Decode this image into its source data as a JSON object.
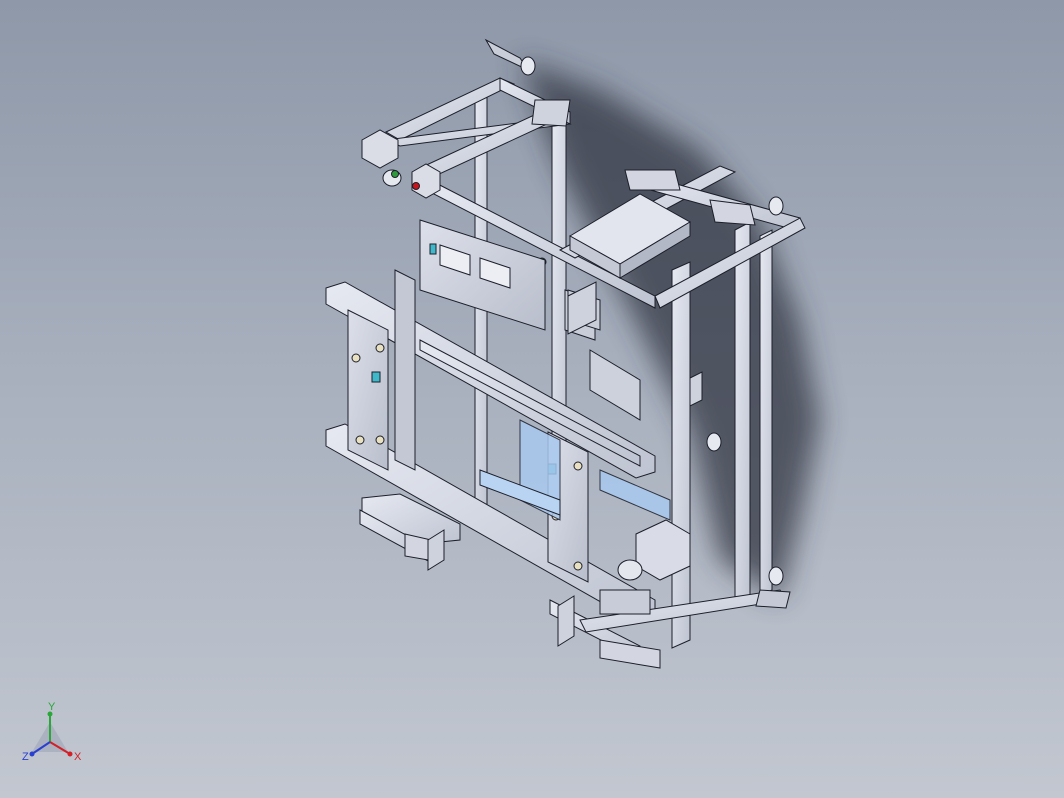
{
  "viewport": {
    "background_top": "#8e98a8",
    "background_bottom": "#c2c7d0",
    "model_color": "#d7dbe6",
    "edge_color": "#1c1f2a",
    "accent_blue": "#a8c8ee",
    "accent_teal": "#3fb9c9",
    "indicator_green": "#2e9a3a",
    "indicator_red": "#c8141c"
  },
  "triad": {
    "icon": "coordinate-triad-icon",
    "x_label": "X",
    "y_label": "Y",
    "z_label": "Z",
    "x_color": "#d31f26",
    "y_color": "#2aa63a",
    "z_color": "#2a3fd0"
  }
}
